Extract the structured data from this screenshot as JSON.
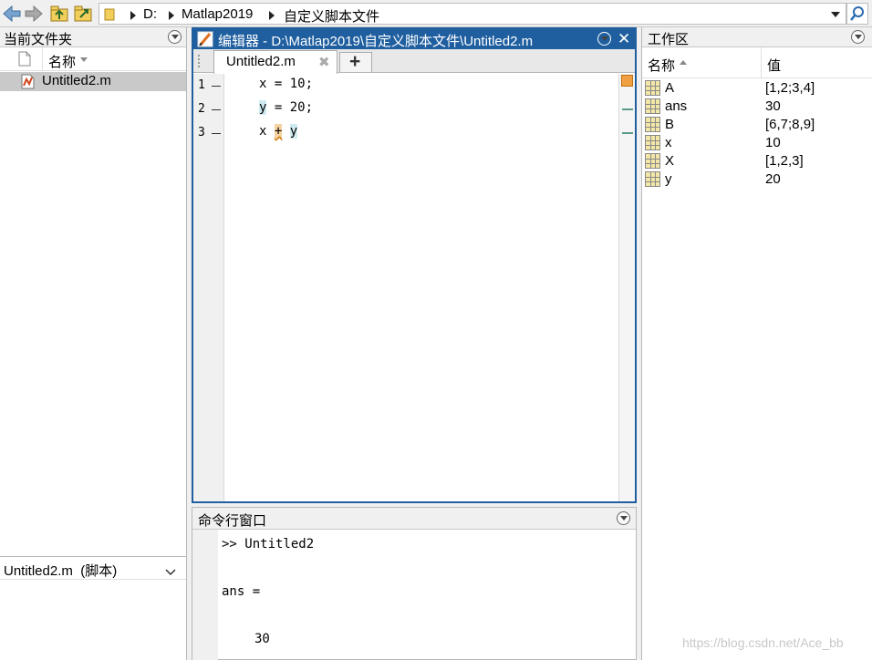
{
  "address_bar": {
    "path": [
      "D:",
      "Matlap2019",
      "自定义脚本文件"
    ]
  },
  "current_folder": {
    "title": "当前文件夹",
    "column_name": "名称",
    "files": [
      {
        "name": "Untitled2.m"
      }
    ],
    "details_label": "Untitled2.m  (脚本)"
  },
  "editor": {
    "title": "编辑器 - D:\\Matlap2019\\自定义脚本文件\\Untitled2.m",
    "tab_label": "Untitled2.m",
    "add_tab_label": "+",
    "lines": [
      {
        "no": "1",
        "a": "x",
        "b": " = 10;"
      },
      {
        "no": "2",
        "a": "y",
        "b": " = 20;"
      },
      {
        "no": "3",
        "a": "x ",
        "op": "+",
        "c": "y"
      }
    ]
  },
  "command_window": {
    "title": "命令行窗口",
    "lines": [
      ">> Untitled2",
      "ans =",
      "30"
    ]
  },
  "workspace": {
    "title": "工作区",
    "col_name": "名称",
    "col_value": "值",
    "variables": [
      {
        "name": "A",
        "value": "[1,2;3,4]"
      },
      {
        "name": "ans",
        "value": "30"
      },
      {
        "name": "B",
        "value": "[6,7;8,9]"
      },
      {
        "name": "x",
        "value": "10"
      },
      {
        "name": "X",
        "value": "[1,2,3]"
      },
      {
        "name": "y",
        "value": "20"
      }
    ]
  },
  "watermark": "https://blog.csdn.net/Ace_bb",
  "colors": {
    "accent": "#1f5fa0",
    "selected_row": "#c9c9c9",
    "warning_marker": "#f0a040"
  }
}
